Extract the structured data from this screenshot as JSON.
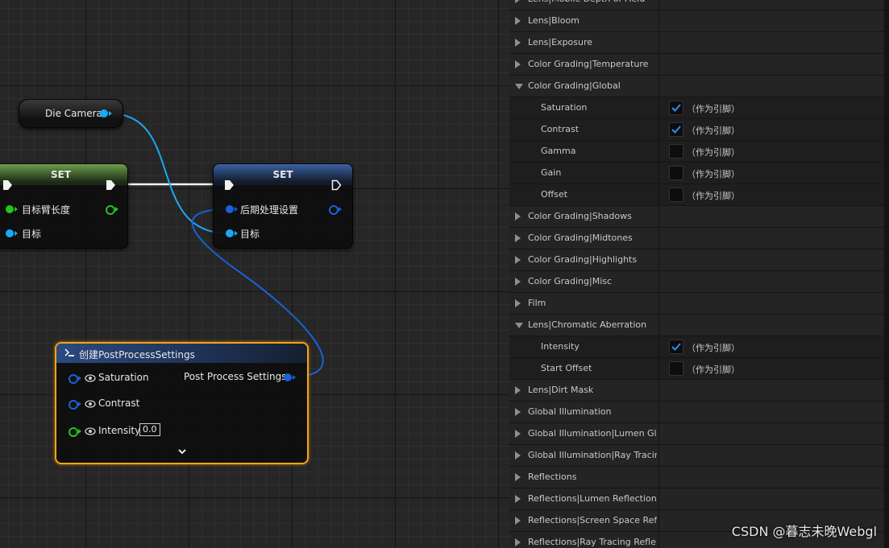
{
  "graph": {
    "variable_node": {
      "label": "Die Camera"
    },
    "set_node_left": {
      "title": "SET",
      "pins": [
        "目标臂长度",
        "目标"
      ]
    },
    "set_node_right": {
      "title": "SET",
      "pins": [
        "后期处理设置",
        "目标"
      ]
    },
    "make_node": {
      "title": "创建PostProcessSettings",
      "inputs": [
        "Saturation",
        "Contrast",
        "Intensity"
      ],
      "intensity_value": "0.0",
      "output": "Post Process Settings"
    }
  },
  "details": {
    "rows": [
      {
        "label": "Lens|Mobile Depth of Field",
        "kind": "category",
        "expanded": false
      },
      {
        "label": "Lens|Bloom",
        "kind": "category",
        "expanded": false
      },
      {
        "label": "Lens|Exposure",
        "kind": "category",
        "expanded": false
      },
      {
        "label": "Color Grading|Temperature",
        "kind": "category",
        "expanded": false
      },
      {
        "label": "Color Grading|Global",
        "kind": "category",
        "expanded": true
      },
      {
        "label": "Saturation",
        "kind": "property",
        "checked": true,
        "pin_text": "（作为引脚）"
      },
      {
        "label": "Contrast",
        "kind": "property",
        "checked": true,
        "pin_text": "（作为引脚）"
      },
      {
        "label": "Gamma",
        "kind": "property",
        "checked": false,
        "pin_text": "（作为引脚）"
      },
      {
        "label": "Gain",
        "kind": "property",
        "checked": false,
        "pin_text": "（作为引脚）"
      },
      {
        "label": "Offset",
        "kind": "property",
        "checked": false,
        "pin_text": "（作为引脚）"
      },
      {
        "label": "Color Grading|Shadows",
        "kind": "category",
        "expanded": false
      },
      {
        "label": "Color Grading|Midtones",
        "kind": "category",
        "expanded": false
      },
      {
        "label": "Color Grading|Highlights",
        "kind": "category",
        "expanded": false
      },
      {
        "label": "Color Grading|Misc",
        "kind": "category",
        "expanded": false
      },
      {
        "label": "Film",
        "kind": "category",
        "expanded": false
      },
      {
        "label": "Lens|Chromatic Aberration",
        "kind": "category",
        "expanded": true
      },
      {
        "label": "Intensity",
        "kind": "property",
        "checked": true,
        "pin_text": "（作为引脚）"
      },
      {
        "label": "Start Offset",
        "kind": "property",
        "checked": false,
        "pin_text": "（作为引脚）"
      },
      {
        "label": "Lens|Dirt Mask",
        "kind": "category",
        "expanded": false
      },
      {
        "label": "Global Illumination",
        "kind": "category",
        "expanded": false
      },
      {
        "label": "Global Illumination|Lumen Glo...",
        "kind": "category",
        "expanded": false
      },
      {
        "label": "Global Illumination|Ray Tracin...",
        "kind": "category",
        "expanded": false
      },
      {
        "label": "Reflections",
        "kind": "category",
        "expanded": false
      },
      {
        "label": "Reflections|Lumen Reflections",
        "kind": "category",
        "expanded": false
      },
      {
        "label": "Reflections|Screen Space Refl...",
        "kind": "category",
        "expanded": false
      },
      {
        "label": "Reflections|Ray Tracing Refle...",
        "kind": "category",
        "expanded": false
      }
    ]
  },
  "watermark": "CSDN @暮志未晚Webgl",
  "colors": {
    "object_pin": "#1aa9f4",
    "struct_pin": "#1862d6",
    "float_pin": "#25c41f",
    "selected_outline": "#f0a51c"
  }
}
